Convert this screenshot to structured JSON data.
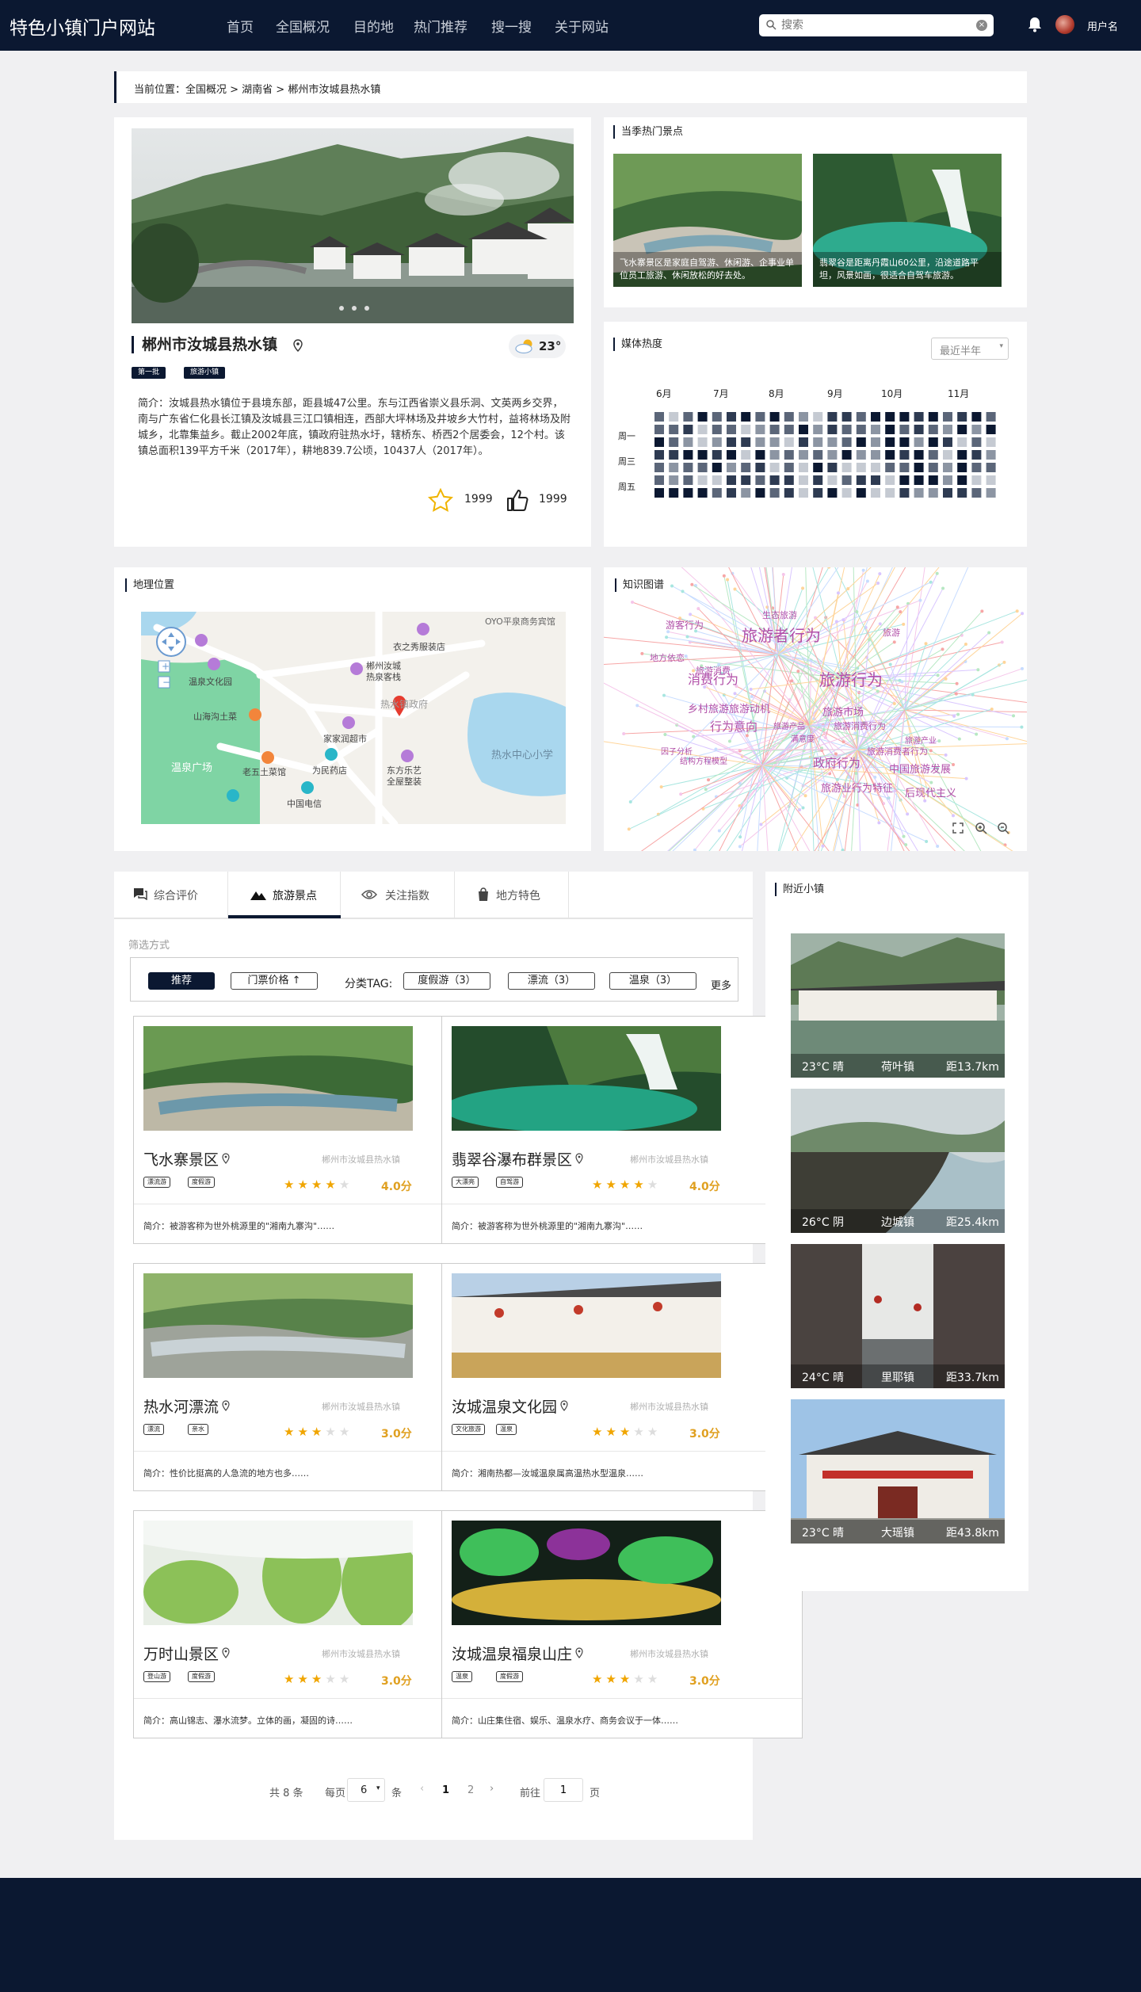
{
  "header": {
    "brand": "特色小镇门户网站",
    "nav": [
      "首页",
      "全国概况",
      "目的地",
      "热门推荐",
      "搜一搜",
      "关于网站"
    ],
    "search_placeholder": "搜索",
    "username": "用户名"
  },
  "breadcrumb": "当前位置：全国概况 > 湖南省 > 郴州市汝城县热水镇",
  "town": {
    "name": "郴州市汝城县热水镇",
    "tags": [
      "第一批",
      "旅游小镇"
    ],
    "weather": "23°",
    "intro": "简介：汝城县热水镇位于县境东部，距县城47公里。东与江西省崇义县乐洞、文英两乡交界，南与广东省仁化县长江镇及汝城县三江口镇相连，西部大坪林场及井坡乡大竹村，益将林场及附城乡，北靠集益乡。截止2002年底，镇政府驻热水圩，辖桥东、桥西2个居委会，12个村。该镇总面积139平方千米（2017年），耕地839.7公顷，10437人（2017年）。",
    "favorites": "1999",
    "likes": "1999"
  },
  "hot_spots": {
    "title": "当季热门景点",
    "items": [
      {
        "caption": "飞水寨景区是家庭自驾游、休闲游、企事业单位员工旅游、休闲放松的好去处。"
      },
      {
        "caption": "翡翠谷是距离丹霞山60公里，沿途道路平坦，风景如画，很适合自驾车旅游。"
      }
    ]
  },
  "media_heat": {
    "title": "媒体热度",
    "range": "最近半年",
    "months": [
      "6月",
      "7月",
      "8月",
      "9月",
      "10月",
      "11月"
    ],
    "weekdays": [
      "周一",
      "周三",
      "周五"
    ],
    "colors": [
      "#0b1831",
      "#2e3b52",
      "#5b6679",
      "#8c95a3",
      "#c5cad2"
    ]
  },
  "geo": {
    "title": "地理位置",
    "labels": [
      "OYO平泉商务宾馆",
      "衣之秀服装店",
      "郴州汝城",
      "热泉客栈",
      "温泉文化园",
      "热水镇政府",
      "山海沟土菜",
      "家家润超市",
      "温泉广场",
      "老五土菜馆",
      "为民药店",
      "东方乐艺",
      "全屋整装",
      "热水中心小学",
      "中国电信"
    ]
  },
  "kg": {
    "title": "知识图谱",
    "words": [
      "旅游者行为",
      "消费行为",
      "旅游行为",
      "游客行为",
      "旅游消费",
      "生态旅游",
      "旅游",
      "地方依恋",
      "乡村旅游旅游动机",
      "旅游市场",
      "行为意向",
      "旅游产品",
      "旅游消费行为",
      "满意度",
      "旅游产业",
      "因子分析",
      "结构方程模型",
      "政府行为",
      "旅游消费者行为",
      "中国旅游发展",
      "旅游业行为特征",
      "后现代主义"
    ]
  },
  "tabs": {
    "items": [
      "综合评价",
      "旅游景点",
      "关注指数",
      "地方特色"
    ],
    "active": 1,
    "filter_label": "筛选方式",
    "recommend": "推荐",
    "price": "门票价格 ↑",
    "tag_label": "分类TAG:",
    "tag_chips": [
      "度假游（3）",
      "漂流（3）",
      "温泉（3）"
    ],
    "more": "更多"
  },
  "spots": [
    {
      "name": "飞水寨景区",
      "loc": "郴州市汝城县热水镇",
      "tags": [
        "漂流游",
        "度假游"
      ],
      "score": "4.0分",
      "stars": 4,
      "desc": "简介：被游客称为世外桃源里的\"湘南九寨沟\"……"
    },
    {
      "name": "翡翠谷瀑布群景区",
      "loc": "郴州市汝城县热水镇",
      "tags": [
        "大漂亮",
        "自驾游"
      ],
      "score": "4.0分",
      "stars": 4,
      "desc": "简介：被游客称为世外桃源里的\"湘南九寨沟\"……"
    },
    {
      "name": "热水河漂流",
      "loc": "郴州市汝城县热水镇",
      "tags": [
        "漂流",
        "亲水"
      ],
      "score": "3.0分",
      "stars": 3,
      "desc": "简介：性价比挺高的人急流的地方也多……"
    },
    {
      "name": "汝城温泉文化园",
      "loc": "郴州市汝城县热水镇",
      "tags": [
        "文化旅游",
        "温泉"
      ],
      "score": "3.0分",
      "stars": 3,
      "desc": "简介：湘南热都—汝城温泉属高温热水型温泉……"
    },
    {
      "name": "万时山景区",
      "loc": "郴州市汝城县热水镇",
      "tags": [
        "登山游",
        "度假游"
      ],
      "score": "3.0分",
      "stars": 3,
      "desc": "简介：高山锦志、瀑水流梦。立体的画，凝固的诗……"
    },
    {
      "name": "汝城温泉福泉山庄",
      "loc": "郴州市汝城县热水镇",
      "tags": [
        "温泉",
        "度假游"
      ],
      "score": "3.0分",
      "stars": 3,
      "desc": "简介：山庄集住宿、娱乐、温泉水疗、商务会议于一体……"
    }
  ],
  "pagination": {
    "total": "共 8 条",
    "per_page_prefix": "每页",
    "per_page": "6",
    "per_page_suffix": "条",
    "pages": [
      "1",
      "2"
    ],
    "goto_prefix": "前往",
    "goto_value": "1",
    "goto_suffix": "页"
  },
  "nearby": {
    "title": "附近小镇",
    "items": [
      {
        "weather": "23°C 晴",
        "name": "荷叶镇",
        "dist": "距13.7km"
      },
      {
        "weather": "26°C 阴",
        "name": "边城镇",
        "dist": "距25.4km"
      },
      {
        "weather": "24°C 晴",
        "name": "里耶镇",
        "dist": "距33.7km"
      },
      {
        "weather": "23°C 晴",
        "name": "大瑶镇",
        "dist": "距43.8km"
      }
    ]
  }
}
